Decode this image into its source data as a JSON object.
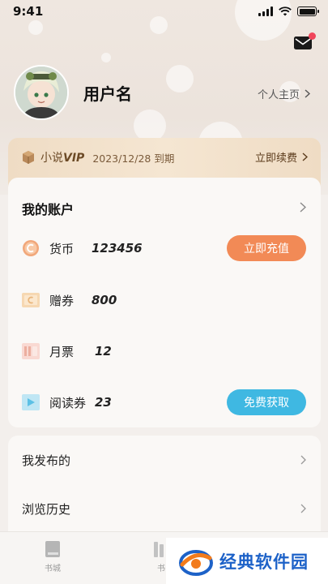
{
  "status_bar": {
    "time": "9:41"
  },
  "profile": {
    "username": "用户名",
    "homepage_label": "个人主页"
  },
  "vip": {
    "title_prefix": "小说",
    "title_vip": "VIP",
    "expiry": "2023/12/28 到期",
    "renew_label": "立即续费"
  },
  "account": {
    "title": "我的账户",
    "rows": [
      {
        "label": "货币",
        "value": "123456",
        "action": "立即充值",
        "icon": "coin-icon"
      },
      {
        "label": "赠券",
        "value": "800",
        "icon": "coupon-icon"
      },
      {
        "label": "月票",
        "value": "12",
        "icon": "ticket-icon"
      },
      {
        "label": "阅读券",
        "value": "23",
        "action": "免费获取",
        "icon": "read-ticket-icon"
      }
    ]
  },
  "menu": [
    {
      "label": "我发布的"
    },
    {
      "label": "浏览历史"
    }
  ],
  "tabbar": [
    {
      "label": "书城",
      "icon": "book-icon"
    },
    {
      "label": "书",
      "icon": "bookshelf-icon"
    }
  ],
  "watermark": {
    "text": "经典软件园"
  },
  "colors": {
    "accent_orange": "#f28a56",
    "accent_blue": "#3fb8e2",
    "vip_bg": "#f2e1ca",
    "badge_red": "#f0455a"
  }
}
